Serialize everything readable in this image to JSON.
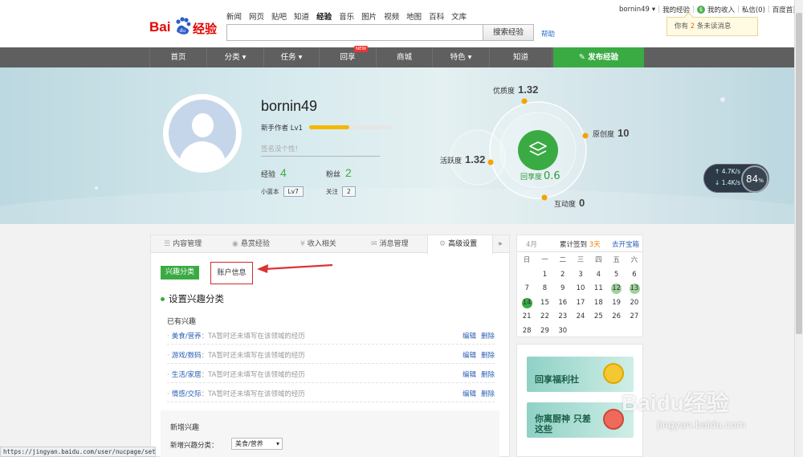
{
  "logo": {
    "text1": "Bai",
    "paw_text": "du",
    "text2": "经验"
  },
  "search_nav": [
    {
      "label": "新闻",
      "current": false
    },
    {
      "label": "网页",
      "current": false
    },
    {
      "label": "贴吧",
      "current": false
    },
    {
      "label": "知道",
      "current": false
    },
    {
      "label": "经验",
      "current": true
    },
    {
      "label": "音乐",
      "current": false
    },
    {
      "label": "图片",
      "current": false
    },
    {
      "label": "视频",
      "current": false
    },
    {
      "label": "地图",
      "current": false
    },
    {
      "label": "百科",
      "current": false
    },
    {
      "label": "文库",
      "current": false
    }
  ],
  "search": {
    "value": "",
    "button": "搜索经验",
    "help": "帮助"
  },
  "userbar": {
    "username": "bornin49",
    "dropdown_icon": "▾",
    "sep": "|",
    "my_exp": "我的经验",
    "money_icon": "$",
    "my_income": "我的收入",
    "messages": "私信(0)",
    "home": "百度首页"
  },
  "notification": {
    "prefix": "你有",
    "count": "2",
    "suffix": "条未读消息"
  },
  "main_nav": {
    "items": [
      "首页",
      "分类 ▾",
      "任务 ▾",
      "回享",
      "商城",
      "特色 ▾",
      "知道"
    ],
    "new_badge": "NEW",
    "publish": "发布经验",
    "publish_icon": "✎"
  },
  "profile": {
    "username": "bornin49",
    "level_label": "新手作者 Lv1",
    "level_progress": 0.48,
    "signature_placeholder": "签名没个性!",
    "experience_label": "经验",
    "experience_value": "4",
    "fans_label": "粉丝",
    "fans_value": "2",
    "blue_label": "小蓝本",
    "blue_value": "Lv7",
    "follow_label": "关注",
    "follow_value": "2"
  },
  "radar": {
    "quality_label": "优质度",
    "quality_value": "1.32",
    "original_label": "原创度",
    "original_value": "10",
    "activity_label": "活跃度",
    "activity_value": "1.32",
    "interaction_label": "互动度",
    "interaction_value": "0",
    "share_label": "回享度",
    "share_value": "0.6"
  },
  "net_widget": {
    "up": "4.7",
    "down": "1.4",
    "unit": "K/s",
    "percent": "84",
    "percent_sign": "%"
  },
  "tabs": [
    {
      "icon": "☰",
      "label": "内容管理",
      "current": false
    },
    {
      "icon": "◉",
      "label": "悬赏经验",
      "current": false
    },
    {
      "icon": "¥",
      "label": "收入相关",
      "current": false
    },
    {
      "icon": "✉",
      "label": "消息管理",
      "current": false
    },
    {
      "icon": "⚙",
      "label": "高级设置",
      "current": true
    }
  ],
  "tabs_more": "»",
  "settings": {
    "interest_button": "兴趣分类",
    "account_button": "账户信息",
    "section_title": "设置兴趣分类",
    "has_interest_title": "已有兴趣",
    "interests": [
      {
        "name": "美食/营养",
        "desc": "：TA暂时还未填写在该领域的经历"
      },
      {
        "name": "游戏/数码",
        "desc": "：TA暂时还未填写在该领域的经历"
      },
      {
        "name": "生活/家居",
        "desc": "：TA暂时还未填写在该领域的经历"
      },
      {
        "name": "情感/交际",
        "desc": "：TA暂时还未填写在该领域的经历"
      }
    ],
    "edit_label": "编辑",
    "delete_label": "删除",
    "new_interest_title": "新增兴趣",
    "new_interest_label": "新增兴趣分类：",
    "new_interest_select": "美食/营养"
  },
  "calendar": {
    "month": "4月",
    "checkin_prefix": "累计签到",
    "checkin_days": "3天",
    "open_chest": "去开宝箱",
    "weekdays": [
      "日",
      "一",
      "二",
      "三",
      "四",
      "五",
      "六"
    ],
    "days": [
      {
        "d": "",
        "c": 0
      },
      {
        "d": "1",
        "c": 0
      },
      {
        "d": "2",
        "c": 0
      },
      {
        "d": "3",
        "c": 0
      },
      {
        "d": "4",
        "c": 0
      },
      {
        "d": "5",
        "c": 0
      },
      {
        "d": "6",
        "c": 0
      },
      {
        "d": "7",
        "c": 0
      },
      {
        "d": "8",
        "c": 0
      },
      {
        "d": "9",
        "c": 0
      },
      {
        "d": "10",
        "c": 0
      },
      {
        "d": "11",
        "c": 0
      },
      {
        "d": "12",
        "c": 1
      },
      {
        "d": "13",
        "c": 1
      },
      {
        "d": "14",
        "c": 2
      },
      {
        "d": "15",
        "c": 0
      },
      {
        "d": "16",
        "c": 0
      },
      {
        "d": "17",
        "c": 0
      },
      {
        "d": "18",
        "c": 0
      },
      {
        "d": "19",
        "c": 0
      },
      {
        "d": "20",
        "c": 0
      },
      {
        "d": "21",
        "c": 0
      },
      {
        "d": "22",
        "c": 0
      },
      {
        "d": "23",
        "c": 0
      },
      {
        "d": "24",
        "c": 0
      },
      {
        "d": "25",
        "c": 0
      },
      {
        "d": "26",
        "c": 0
      },
      {
        "d": "27",
        "c": 0
      },
      {
        "d": "28",
        "c": 0
      },
      {
        "d": "29",
        "c": 0
      },
      {
        "d": "30",
        "c": 0
      }
    ]
  },
  "ads": [
    {
      "text": "回享福利社"
    },
    {
      "text": "你离厨神 只差这些"
    }
  ],
  "status_url": "https://jingyan.baidu.com/user/nucpage/setting",
  "watermark": {
    "line1": "Baidu经验",
    "line2": "jingyan.baidu.com"
  }
}
